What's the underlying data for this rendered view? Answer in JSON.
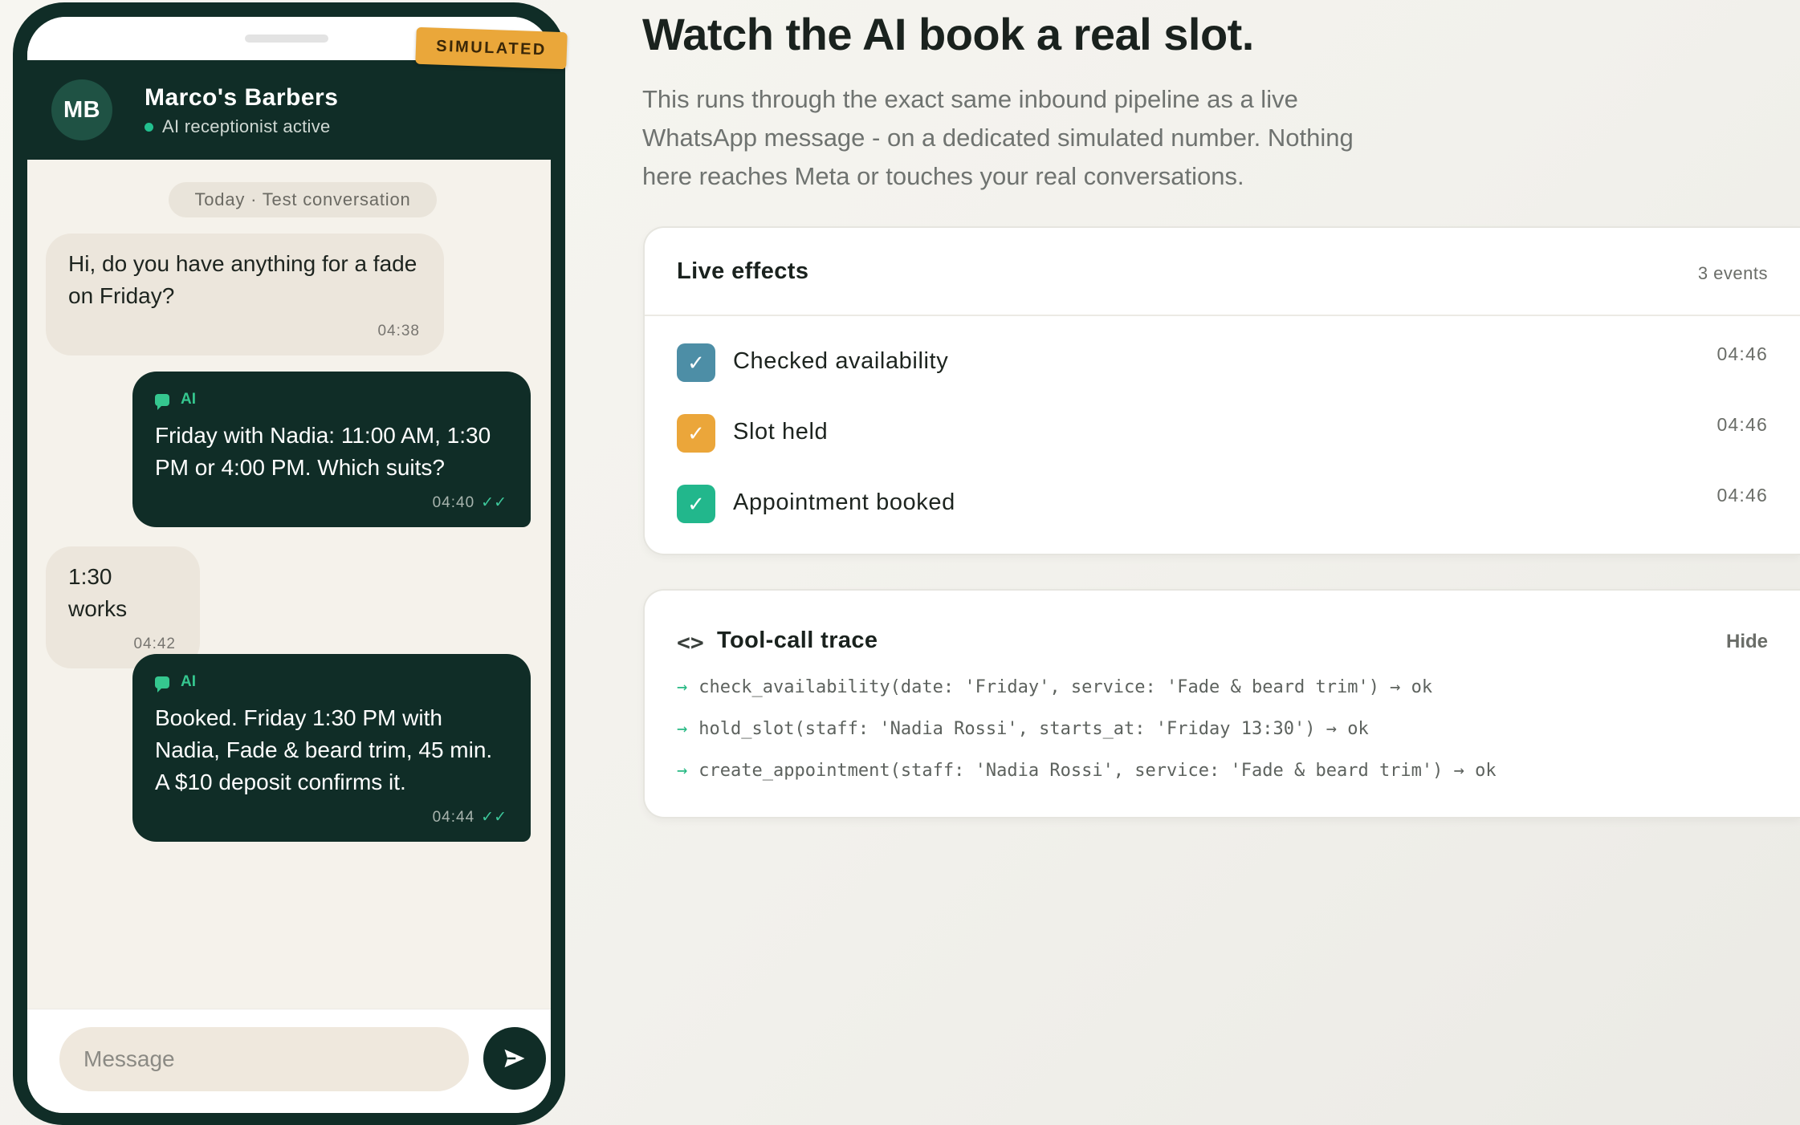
{
  "phone": {
    "business_initials": "MB",
    "business_name": "Marco's Barbers",
    "business_status": "AI receptionist active",
    "badge": "SIMULATED",
    "date_label": "Today · Test conversation",
    "messages": [
      {
        "from": "customer",
        "text": "Hi, do you have anything for a fade on Friday?",
        "time": "04:38"
      },
      {
        "from": "ai",
        "tag": "AI",
        "text": "Friday with Nadia: 11:00 AM, 1:30 PM or 4:00 PM. Which suits?",
        "time": "04:40",
        "ticks": "✓✓"
      },
      {
        "from": "customer",
        "text": "1:30 works",
        "time": "04:42"
      },
      {
        "from": "ai",
        "tag": "AI",
        "text": "Booked. Friday 1:30 PM with Nadia, Fade & beard trim, 45 min. A $10 deposit confirms it.",
        "time": "04:44",
        "ticks": "✓✓"
      }
    ],
    "composer": {
      "placeholder": "Message",
      "send_icon": "send-icon"
    }
  },
  "main": {
    "heading": "Watch the AI book a real slot.",
    "description": "This runs through the exact same inbound pipeline as a live WhatsApp message - on a dedicated simulated number. Nothing here reaches Meta or touches your real conversations."
  },
  "live_effects": {
    "title": "Live effects",
    "count_label": "3 events",
    "items": [
      {
        "label": "Checked availability",
        "time": "04:46",
        "color": "#4d8ea6",
        "icon": "check-icon"
      },
      {
        "label": "Slot held",
        "time": "04:46",
        "color": "#eba63a",
        "icon": "check-icon"
      },
      {
        "label": "Appointment booked",
        "time": "04:46",
        "color": "#22b78c",
        "icon": "check-icon"
      }
    ]
  },
  "trace": {
    "title": "Tool-call trace",
    "hide_label": "Hide",
    "icon": "code-icon",
    "lines": [
      "check_availability(date: 'Friday', service: 'Fade & beard trim') → ok",
      "hold_slot(staff: 'Nadia Rossi', starts_at: 'Friday 13:30') → ok",
      "create_appointment(staff: 'Nadia Rossi', service: 'Fade & beard trim') → ok"
    ]
  },
  "colors": {
    "brand_dark": "#102d27",
    "accent_green": "#22c08f",
    "badge_orange": "#eaa73a"
  }
}
